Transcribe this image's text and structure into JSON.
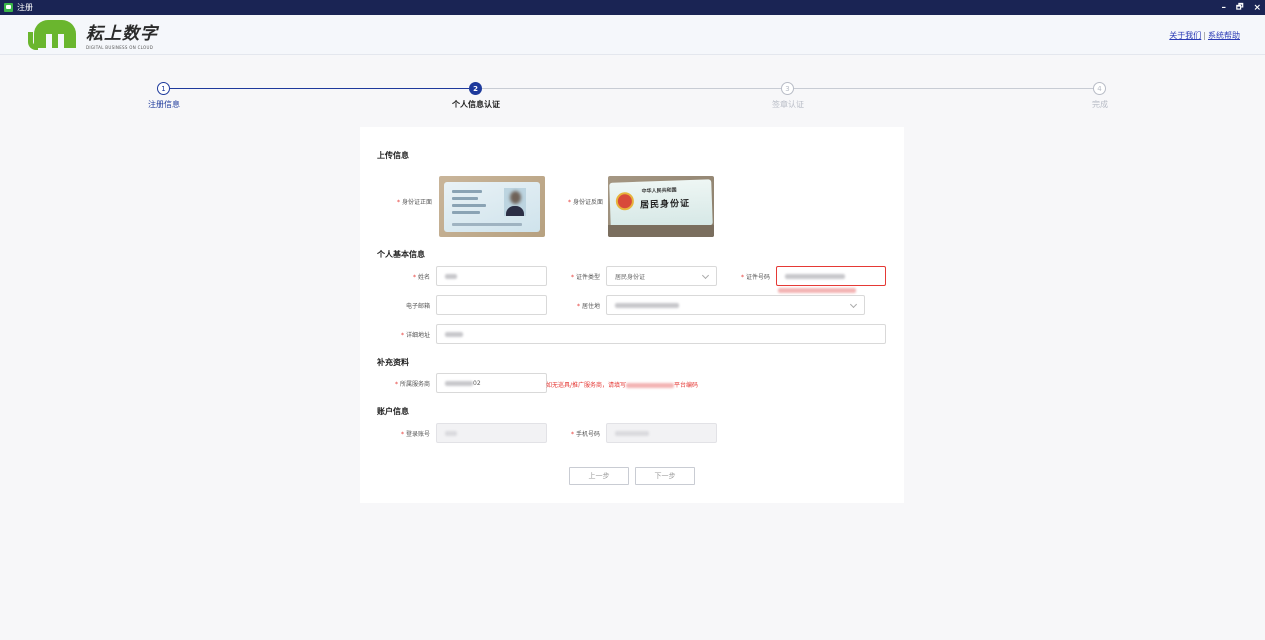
{
  "window": {
    "title": "注册",
    "controls": {
      "minimize": "–",
      "restore": "🗗",
      "close": "×"
    }
  },
  "header": {
    "logo_cn": "耘上数字",
    "logo_en": "DIGITAL BUSINESS ON CLOUD",
    "links": [
      "关于我们",
      "系统帮助"
    ]
  },
  "stepper": {
    "current": 2,
    "steps": [
      {
        "num": "1",
        "label": "注册信息"
      },
      {
        "num": "2",
        "label": "个人信息认证"
      },
      {
        "num": "3",
        "label": "签章认证"
      },
      {
        "num": "4",
        "label": "完成"
      }
    ],
    "colors": {
      "active": "#1e3a9c",
      "inactive": "#b8bcc6"
    }
  },
  "form": {
    "upload": {
      "title": "上传信息",
      "front_label": "身份证正面",
      "back_label": "身份证反面",
      "back_card_text": {
        "line1": "中华人民共和国",
        "line2": "居民身份证"
      }
    },
    "basic": {
      "title": "个人基本信息",
      "name_label": "姓名",
      "id_type_label": "证件类型",
      "id_type_value": "居民身份证",
      "id_number_label": "证件号码",
      "email_label": "电子邮箱",
      "residence_label": "居住地",
      "address_label": "详细地址"
    },
    "supplement": {
      "title": "补充资料",
      "provider_label": "所属服务商",
      "provider_value_suffix": "02",
      "provider_hint_prefix": "如无巡具/推广服务商，请填写",
      "provider_hint_suffix": "平台编码"
    },
    "account": {
      "title": "账户信息",
      "login_label": "登录账号",
      "phone_label": "手机号码"
    },
    "buttons": {
      "prev": "上一步",
      "next": "下一步"
    }
  }
}
